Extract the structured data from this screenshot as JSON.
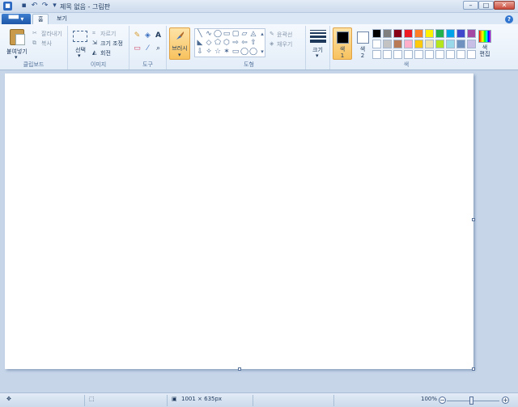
{
  "window": {
    "title": "제목 없음 - 그림판",
    "min": "–",
    "max": "□",
    "close": "✕"
  },
  "quick_access": {
    "save": "▪",
    "undo": "↶",
    "redo": "↷",
    "more": "▾"
  },
  "tabs": {
    "file": "▀▀ ▾",
    "home": "홈",
    "view": "보기",
    "help": "?"
  },
  "clipboard": {
    "paste": "붙여넣기",
    "cut": "잘라내기",
    "copy": "복사",
    "label": "클립보드"
  },
  "image": {
    "select": "선택",
    "crop": "자르기",
    "resize": "크기 조정",
    "rotate": "회전",
    "label": "이미지"
  },
  "tools": {
    "label": "도구",
    "pencil": "✎",
    "fill": "◈",
    "text": "A",
    "eraser": "▭",
    "picker": "⁄",
    "magnifier": "⌕"
  },
  "brushes": {
    "label": "브러시"
  },
  "shapes": {
    "label": "도형",
    "outline": "윤곽선",
    "fill": "채우기",
    "glyphs": [
      "╲",
      "∿",
      "◯",
      "▭",
      "▢",
      "▱",
      "◬",
      "△",
      "◣",
      "◇",
      "⬠",
      "⬡",
      "⇨",
      "⇦",
      "⇧",
      "⇩",
      "✧",
      "☆",
      "✶",
      "▭",
      "◯",
      "◯",
      "○",
      "▾"
    ]
  },
  "size": {
    "label": "크기"
  },
  "colors": {
    "label": "색",
    "color1": "색\n1",
    "color2": "색\n2",
    "edit": "색\n편집",
    "color1_value": "#000000",
    "color2_value": "#ffffff",
    "palette_row1": [
      "#000000",
      "#7f7f7f",
      "#880015",
      "#ed1c24",
      "#ff7f27",
      "#fff200",
      "#22b14c",
      "#00a2e8",
      "#3f48cc",
      "#a349a4"
    ],
    "palette_row2": [
      "#ffffff",
      "#c3c3c3",
      "#b97a57",
      "#ffaec9",
      "#ffc90e",
      "#efe4b0",
      "#b5e61d",
      "#99d9ea",
      "#7092be",
      "#c8bfe7"
    ],
    "palette_row3": [
      "#ffffff",
      "#ffffff",
      "#ffffff",
      "#ffffff",
      "#ffffff",
      "#ffffff",
      "#ffffff",
      "#ffffff",
      "#ffffff",
      "#ffffff"
    ]
  },
  "status": {
    "dimensions": "1001 × 635px",
    "zoom": "100%",
    "zoom_out": "−",
    "zoom_in": "+"
  }
}
